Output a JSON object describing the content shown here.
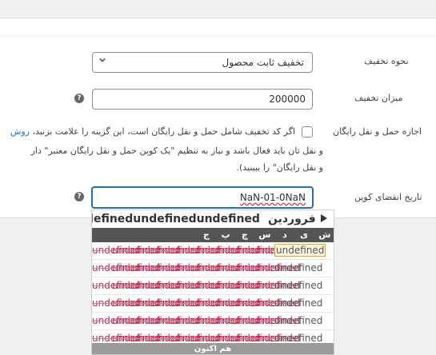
{
  "form": {
    "discount_type": {
      "label": "نحوه تخفیف",
      "value": "تخفیف ثابت محصول"
    },
    "amount": {
      "label": "میزان تخفیف",
      "value": "200000"
    },
    "free_shipping": {
      "label": "اجازه حمل و نقل رایگان",
      "line1_pre": "اگر کد تخفیف شامل حمل و نقل رایگان است، این گزینه را علامت بزنید، ",
      "line1_link": "روش",
      "line2": "و نقل تان باید فعال باشد و نیاز به تنظیم \"یک کوپن حمل و نقل رایگان معتبر\" دار",
      "line3": "و نقل رایگان\" را ببینید)."
    },
    "expiry": {
      "label": "تاریخ انقضای کوپن",
      "value": "NaN-01-0NaN"
    }
  },
  "calendar": {
    "month": "فروردین",
    "year": "undefinedundefinedundefined",
    "weekdays": [
      "ش",
      "ی",
      "د",
      "س",
      "چ",
      "پ",
      "ج"
    ],
    "rows": [
      [
        "undefined",
        "undefined",
        "undefined",
        "undefined",
        "undefined",
        "undefined",
        "undefined",
        "undefined",
        "undefined",
        "undefined"
      ],
      [
        "undefined",
        "undefined",
        "undefined",
        "undefined",
        "undefined",
        "undefined",
        "undefined",
        "undefined",
        "undefined",
        "undefined"
      ],
      [
        "undefined",
        "undefined",
        "undefined",
        "undefined",
        "undefined",
        "undefined",
        "undefined",
        "undefined",
        "undefined",
        "undefined"
      ],
      [
        "undefined",
        "undefined",
        "undefined",
        "undefined",
        "undefined",
        "undefined",
        "undefined",
        "undefined",
        "undefined",
        "undefined"
      ],
      [
        "undefined",
        "undefined",
        "undefined",
        "undefined",
        "undefined",
        "undefined",
        "undefined",
        "undefined",
        "undefined",
        "undefined"
      ],
      [
        "undefined",
        "undefined",
        "undefined",
        "undefined",
        "undefined",
        "undefined",
        "undefined",
        "undefined",
        "undefined",
        "undefined"
      ]
    ],
    "today_label": "هم اکنون"
  },
  "colors": {
    "accent": "#2271b1",
    "error": "#c7254e",
    "header_bg": "#555555",
    "footer_bg": "#9a9a9a"
  },
  "icons": {
    "help": "help-icon",
    "select": "chevron-down-icon",
    "next": "next-month-icon"
  }
}
